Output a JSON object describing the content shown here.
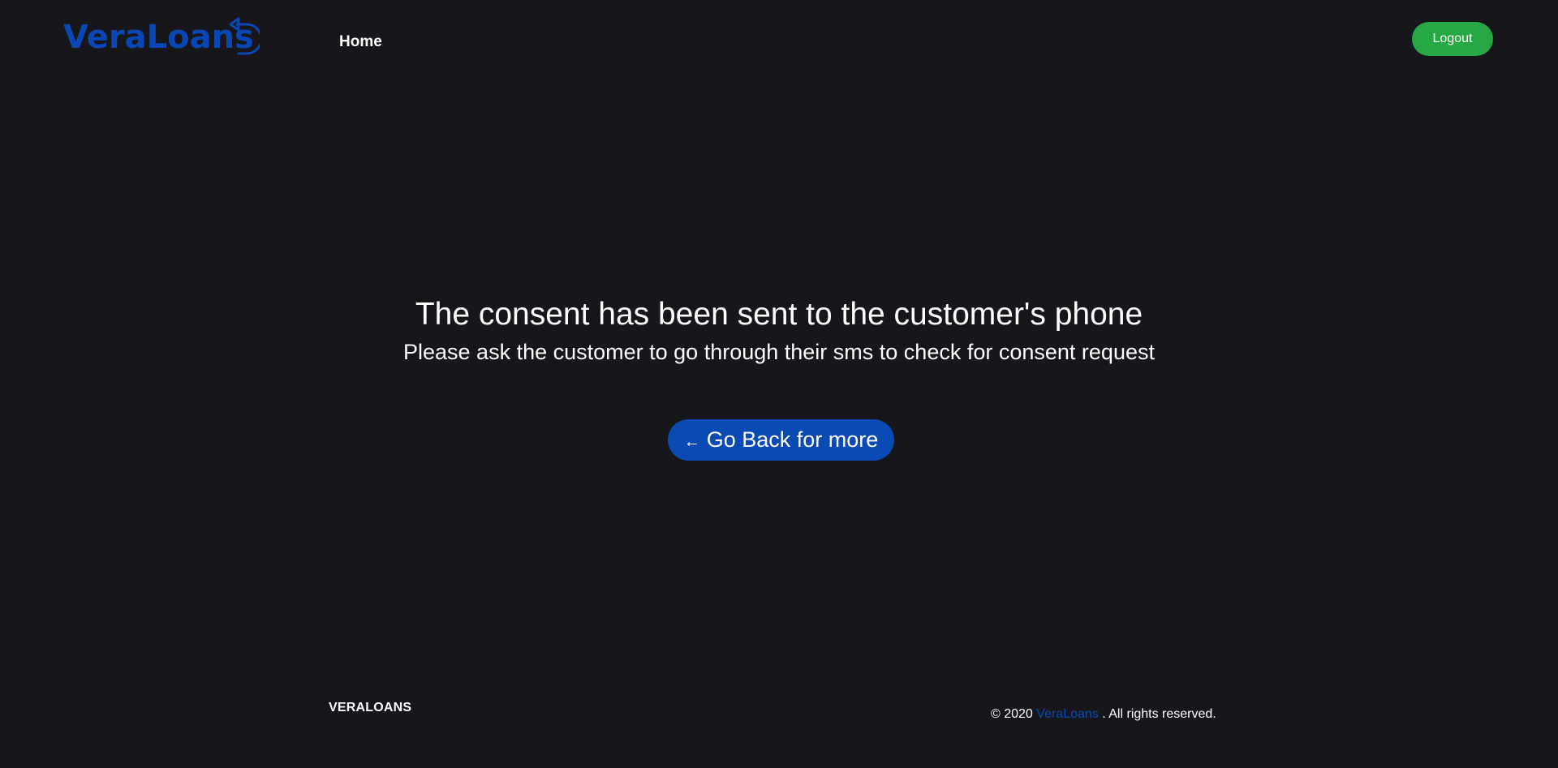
{
  "header": {
    "logo_text": "VeraLoans",
    "logo_color": "#0a47b5",
    "nav_home_label": "Home",
    "logout_label": "Logout",
    "logout_color": "#28a745"
  },
  "main": {
    "title": "The consent has been sent to the customer's phone",
    "subtitle": "Please ask the customer to go through their sms to check for consent request",
    "back_button": {
      "icon": "←",
      "label": "Go Back for more",
      "color": "#0a4ab5"
    }
  },
  "footer": {
    "brand": "VERALOANS",
    "copyright_prefix": "© 2020",
    "copyright_link": "VeraLoans",
    "copyright_suffix": ". All rights reserved.",
    "link_color": "#0a4ab5"
  },
  "colors": {
    "background": "#17161b",
    "text": "#ffffff"
  }
}
